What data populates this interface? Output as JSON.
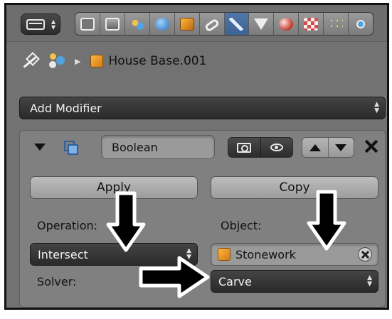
{
  "header": {
    "tabs": [
      {
        "icon": "render-icon"
      },
      {
        "icon": "render-layers-icon"
      },
      {
        "icon": "scene-icon"
      },
      {
        "icon": "world-icon"
      },
      {
        "icon": "object-icon"
      },
      {
        "icon": "constraints-icon"
      },
      {
        "icon": "modifiers-icon",
        "active": true
      },
      {
        "icon": "data-icon"
      },
      {
        "icon": "material-icon"
      },
      {
        "icon": "texture-icon"
      },
      {
        "icon": "particles-icon"
      },
      {
        "icon": "physics-icon"
      }
    ]
  },
  "breadcrumb": {
    "object_name": "House Base.001"
  },
  "add_modifier": {
    "label": "Add Modifier"
  },
  "modifier": {
    "name": "Boolean",
    "apply_label": "Apply",
    "copy_label": "Copy",
    "operation_label": "Operation:",
    "operation_value": "Intersect",
    "object_label": "Object:",
    "object_value": "Stonework",
    "solver_label": "Solver:",
    "solver_value": "Carve"
  },
  "colors": {
    "panel_bg": "#727272",
    "active_tab": "#4f77a8",
    "dropdown_bg": "#333333",
    "object_icon": "#f0a030"
  }
}
